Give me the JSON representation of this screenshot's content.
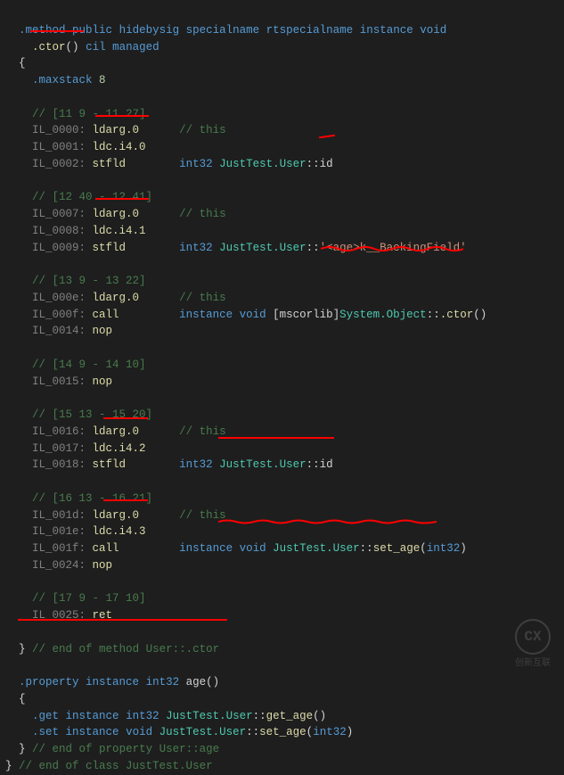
{
  "chart_data": {
    "type": "table",
    "title": "IL (Intermediate Language) disassembly of User class constructor and age property",
    "method_signature": ".method public hidebysig specialname rtspecialname instance void .ctor() cil managed",
    "maxstack": 8,
    "instructions": [
      {
        "section_comment": "[11 9 - 11 27]",
        "items": [
          {
            "offset": "IL_0000",
            "op": "ldarg.0",
            "comment": "// this"
          },
          {
            "offset": "IL_0001",
            "op": "ldc.i4.0",
            "comment": ""
          },
          {
            "offset": "IL_0002",
            "op": "stfld",
            "operand": "int32 JustTest.User::id"
          }
        ]
      },
      {
        "section_comment": "[12 40 - 12 41]",
        "items": [
          {
            "offset": "IL_0007",
            "op": "ldarg.0",
            "comment": "// this"
          },
          {
            "offset": "IL_0008",
            "op": "ldc.i4.1",
            "comment": ""
          },
          {
            "offset": "IL_0009",
            "op": "stfld",
            "operand": "int32 JustTest.User::'<age>k__BackingField'"
          }
        ]
      },
      {
        "section_comment": "[13 9 - 13 22]",
        "items": [
          {
            "offset": "IL_000e",
            "op": "ldarg.0",
            "comment": "// this"
          },
          {
            "offset": "IL_000f",
            "op": "call",
            "operand": "instance void [mscorlib]System.Object::.ctor()"
          },
          {
            "offset": "IL_0014",
            "op": "nop",
            "comment": ""
          }
        ]
      },
      {
        "section_comment": "[14 9 - 14 10]",
        "items": [
          {
            "offset": "IL_0015",
            "op": "nop",
            "comment": ""
          }
        ]
      },
      {
        "section_comment": "[15 13 - 15 20]",
        "items": [
          {
            "offset": "IL_0016",
            "op": "ldarg.0",
            "comment": "// this"
          },
          {
            "offset": "IL_0017",
            "op": "ldc.i4.2",
            "comment": ""
          },
          {
            "offset": "IL_0018",
            "op": "stfld",
            "operand": "int32 JustTest.User::id"
          }
        ]
      },
      {
        "section_comment": "[16 13 - 16 21]",
        "items": [
          {
            "offset": "IL_001d",
            "op": "ldarg.0",
            "comment": "// this"
          },
          {
            "offset": "IL_001e",
            "op": "ldc.i4.3",
            "comment": ""
          },
          {
            "offset": "IL_001f",
            "op": "call",
            "operand": "instance void JustTest.User::set_age(int32)"
          },
          {
            "offset": "IL_0024",
            "op": "nop",
            "comment": ""
          }
        ]
      },
      {
        "section_comment": "[17 9 - 17 10]",
        "items": [
          {
            "offset": "IL_0025",
            "op": "ret",
            "comment": ""
          }
        ]
      }
    ],
    "closing_comment_method": "// end of method User::.ctor",
    "property_signature": ".property instance int32 age()",
    "property_get": ".get instance int32 JustTest.User::get_age()",
    "property_set": ".set instance void JustTest.User::set_age(int32)",
    "closing_comment_prop": "// end of property User::age",
    "closing_comment_class": "// end of class JustTest.User"
  },
  "l": {
    "method": ".method",
    "public": "public",
    "hidebysig": "hidebysig",
    "specialname": "specialname",
    "rtspecialname": "rtspecialname",
    "instance": "instance",
    "void": "void",
    "ctor": ".ctor",
    "cil": "cil",
    "managed": "managed",
    "openbrace": "{",
    "closebrace": "}",
    "maxstack": ".maxstack",
    "maxstack_val": "8",
    "c1": "// [11 9 - 11 27]",
    "il0000": "IL_0000:",
    "op_ldarg0": "ldarg.0",
    "cmt_this": "// this",
    "il0001": "IL_0001:",
    "op_ldci40": "ldc.i4.0",
    "il0002": "IL_0002:",
    "op_stfld": "stfld",
    "int32": "int32",
    "justtest_user": "JustTest.User",
    "sep": "::",
    "id": "id",
    "c2": "// [12 40 - 12 41]",
    "il0007": "IL_0007:",
    "il0008": "IL_0008:",
    "op_ldci41": "ldc.i4.1",
    "il0009": "IL_0009:",
    "backing": "'<age>k__BackingField'",
    "c3": "// [13 9 - 13 22]",
    "il000e": "IL_000e:",
    "il000f": "IL_000f:",
    "op_call": "call",
    "mscorlib": "[mscorlib]",
    "sysobj": "System.Object",
    "il0014": "IL_0014:",
    "op_nop": "nop",
    "c4": "// [14 9 - 14 10]",
    "il0015": "IL_0015:",
    "c5": "// [15 13 - 15 20]",
    "il0016": "IL_0016:",
    "il0017": "IL_0017:",
    "op_ldci42": "ldc.i4.2",
    "il0018": "IL_0018:",
    "c6": "// [16 13 - 16 21]",
    "il001d": "IL_001d:",
    "il001e": "IL_001e:",
    "op_ldci43": "ldc.i4.3",
    "il001f": "IL_001f:",
    "set_age": "set_age",
    "il0024": "IL_0024:",
    "c7": "// [17 9 - 17 10]",
    "il0025": "IL_0025:",
    "op_ret": "ret",
    "end_method": "// end of method User::.ctor",
    "property": ".property",
    "age": "age",
    "paren": "()",
    "get": ".get",
    "get_age": "get_age",
    "set": ".set",
    "end_prop": "// end of property User::age",
    "end_class": "// end of class JustTest.User",
    "watermark": "创新互联"
  }
}
